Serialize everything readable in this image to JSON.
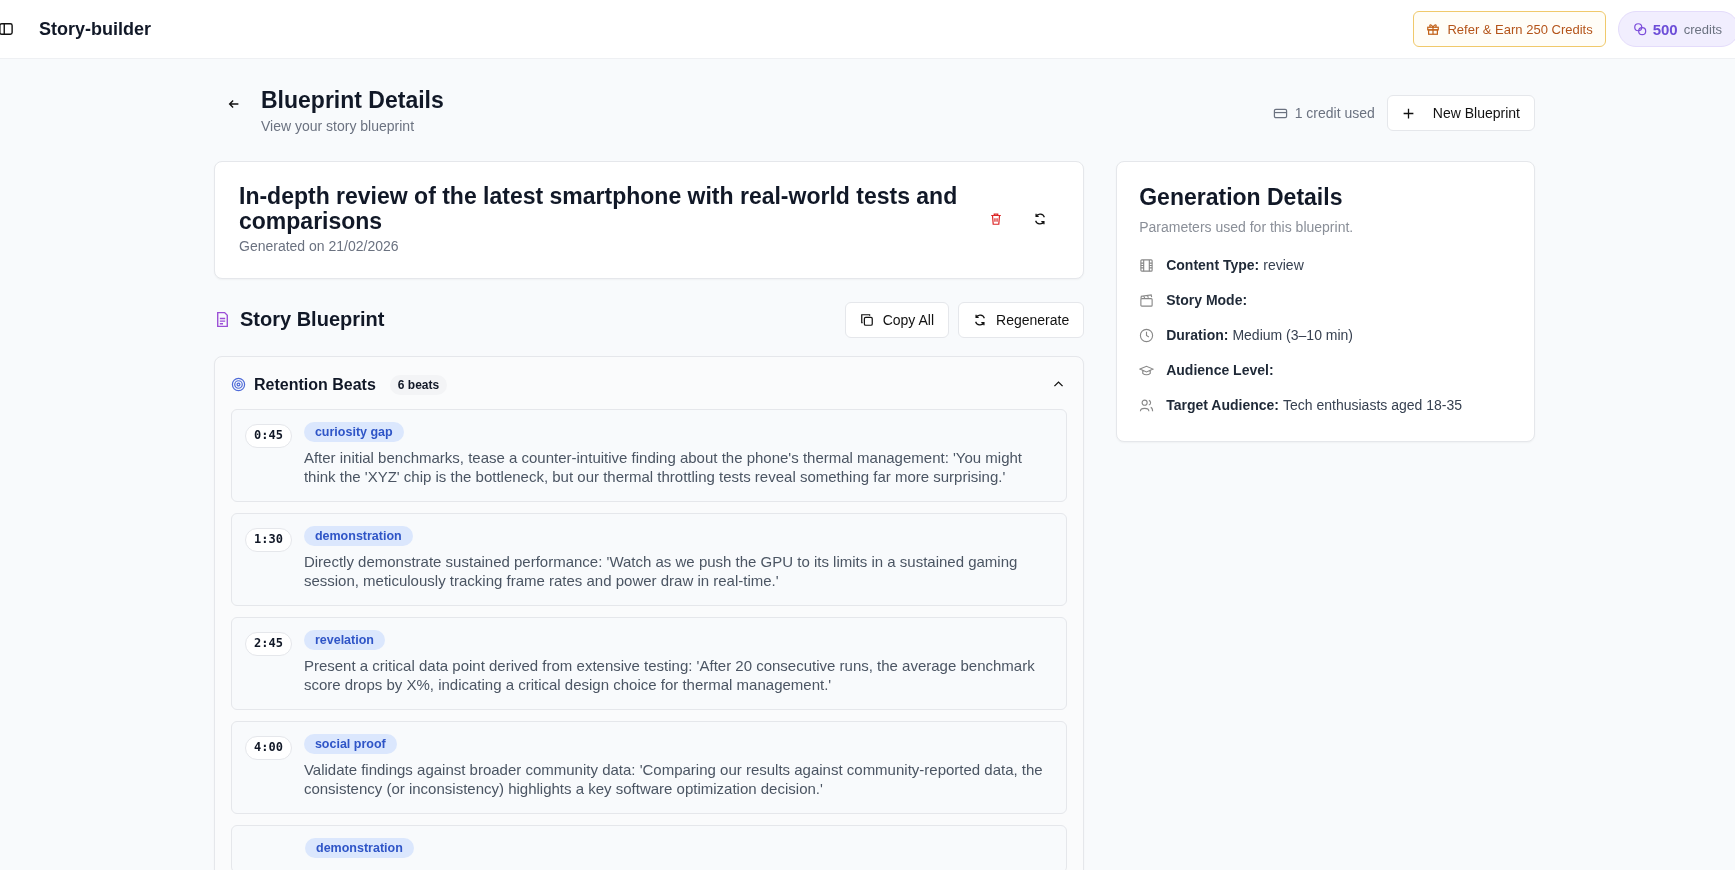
{
  "topbar": {
    "title": "Story-builder",
    "refer_button": "Refer & Earn 250 Credits",
    "credits": {
      "amount": "500",
      "unit": "credits"
    }
  },
  "header": {
    "title": "Blueprint Details",
    "subtitle": "View your story blueprint",
    "credit_note": "1 credit used",
    "new_button": "New Blueprint"
  },
  "blueprint_card": {
    "title": "In-depth review of the latest smartphone with real-world tests and comparisons",
    "generated": "Generated on 21/02/2026"
  },
  "story_blueprint": {
    "title": "Story Blueprint",
    "copy_button": "Copy All",
    "regenerate_button": "Regenerate",
    "retention_beats": {
      "title": "Retention Beats",
      "count": "6 beats",
      "expanded": true,
      "beats": [
        {
          "time": "0:45",
          "tag": "curiosity gap",
          "text": "After initial benchmarks, tease a counter-intuitive finding about the phone's thermal management: 'You might think the 'XYZ' chip is the bottleneck, but our thermal throttling tests reveal something far more surprising.'"
        },
        {
          "time": "1:30",
          "tag": "demonstration",
          "text": "Directly demonstrate sustained performance: 'Watch as we push the GPU to its limits in a sustained gaming session, meticulously tracking frame rates and power draw in real-time.'"
        },
        {
          "time": "2:45",
          "tag": "revelation",
          "text": "Present a critical data point derived from extensive testing: 'After 20 consecutive runs, the average benchmark score drops by X%, indicating a critical design choice for thermal management.'"
        },
        {
          "time": "4:00",
          "tag": "social proof",
          "text": "Validate findings against broader community data: 'Comparing our results against community-reported data, the consistency (or inconsistency) highlights a key software optimization decision.'"
        },
        {
          "tag": "demonstration"
        }
      ]
    }
  },
  "generation_details": {
    "title": "Generation Details",
    "subtitle": "Parameters used for this blueprint.",
    "items": [
      {
        "kind": "film",
        "label": "Content Type:",
        "value": "review"
      },
      {
        "kind": "clapper",
        "label": "Story Mode:"
      },
      {
        "kind": "clock",
        "label": "Duration:",
        "value": "Medium (3–10 min)"
      },
      {
        "kind": "cap",
        "label": "Audience Level:"
      },
      {
        "kind": "users",
        "label": "Target Audience:",
        "value": "Tech enthusiasts aged 18-35"
      }
    ]
  }
}
